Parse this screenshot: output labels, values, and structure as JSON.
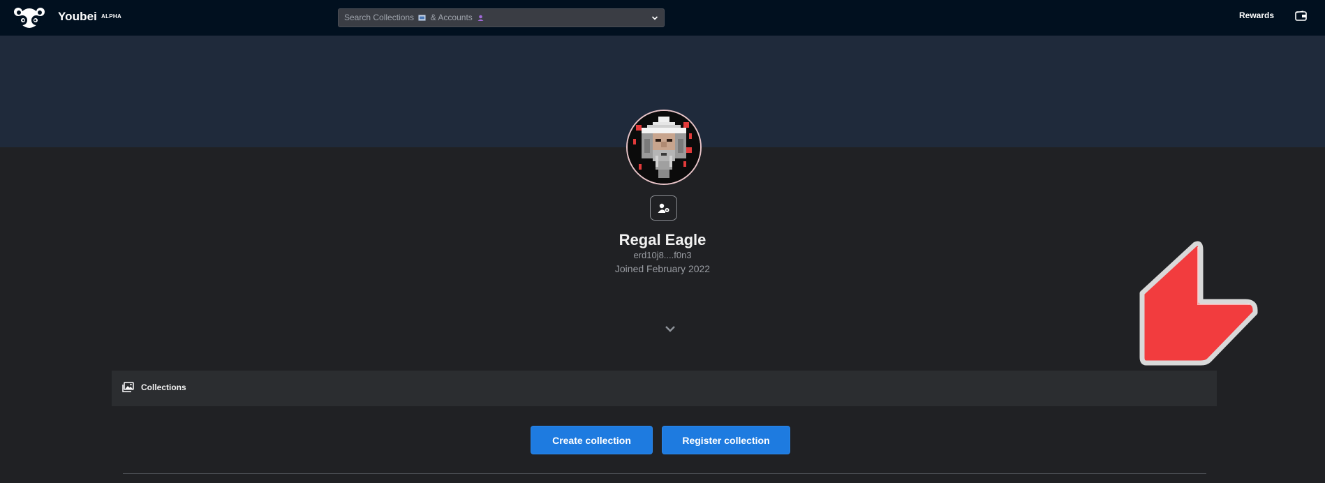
{
  "header": {
    "brand": "Youbei",
    "badge": "ALPHA",
    "search": {
      "placeholder_text": "Search Collections",
      "placeholder_mid": "& Accounts",
      "icons": [
        "collection-emoji-icon",
        "account-emoji-icon"
      ]
    },
    "rewards_label": "Rewards",
    "icons": {
      "logo": "panda-logo-icon",
      "wallet": "wallet-icon",
      "dropdown": "chevron-down-icon"
    }
  },
  "profile": {
    "name": "Regal Eagle",
    "address": "erd10j8....f0n3",
    "joined": "Joined February 2022",
    "avatar_icon": "pixel-wizard-avatar",
    "settings_icon": "user-settings-icon"
  },
  "tabs": {
    "collections_label": "Collections",
    "collections_icon": "images-icon"
  },
  "actions": {
    "create_label": "Create collection",
    "register_label": "Register collection"
  },
  "colors": {
    "topbar": "#01101f",
    "banner": "#1f2a3b",
    "background": "#202124",
    "accent": "#1e7be0",
    "decor_arrow": "#fc3c44"
  }
}
